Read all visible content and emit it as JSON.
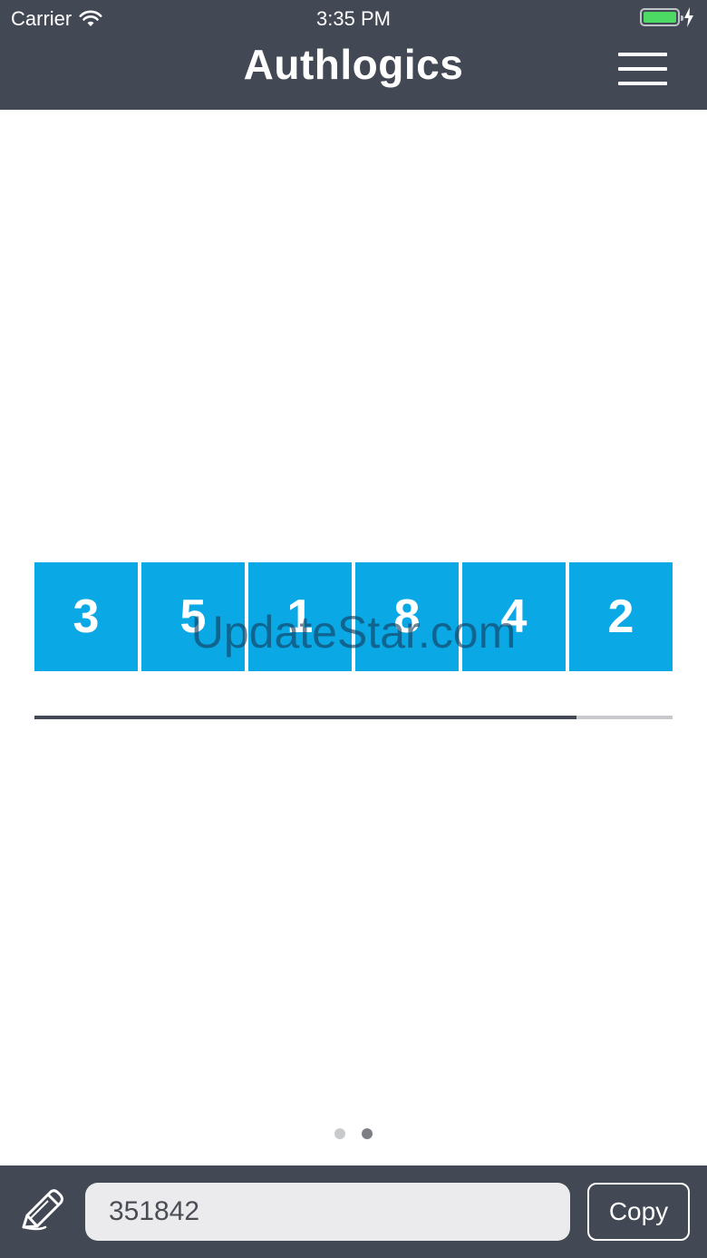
{
  "status_bar": {
    "carrier": "Carrier",
    "time": "3:35 PM",
    "battery_level": 1.0
  },
  "header": {
    "logo": "Authlogics",
    "menu_icon": "hamburger-menu-icon"
  },
  "token": {
    "digits": [
      "3",
      "5",
      "1",
      "8",
      "4",
      "2"
    ],
    "time_remaining_fraction": 0.85
  },
  "watermark": "UpdateStar.com",
  "pager": {
    "total": 2,
    "active_index": 1
  },
  "footer": {
    "edit_icon": "pencil-icon",
    "code_value": "351842",
    "copy_label": "Copy"
  },
  "colors": {
    "bar": "#434855",
    "digit_bg": "#0aa9e6",
    "battery": "#4cd964"
  }
}
